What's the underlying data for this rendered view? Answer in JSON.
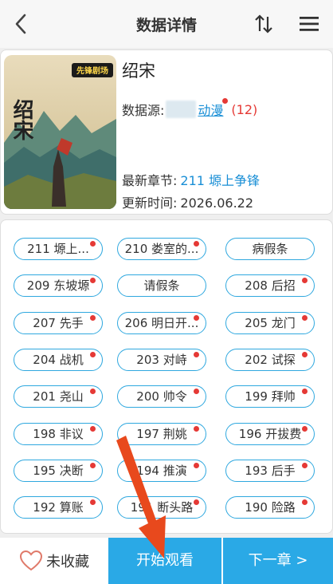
{
  "header": {
    "title": "数据详情"
  },
  "book": {
    "title": "绍宋",
    "cover_logo": "先锋剧场",
    "cover_text": "绍宋",
    "source_label": "数据源:",
    "source_name": "动漫",
    "source_count": "(12)",
    "latest_label": "最新章节:",
    "latest_value": "211 塬上争锋",
    "update_label": "更新时间:",
    "update_value": "2026.06.22"
  },
  "chapters": [
    {
      "label": "211 塬上...",
      "dot": true
    },
    {
      "label": "210 娄室的...",
      "dot": true
    },
    {
      "label": "病假条",
      "dot": false
    },
    {
      "label": "209 东坡塬",
      "dot": true
    },
    {
      "label": "请假条",
      "dot": false
    },
    {
      "label": "208 后招",
      "dot": true
    },
    {
      "label": "207 先手",
      "dot": true
    },
    {
      "label": "206 明日开...",
      "dot": true
    },
    {
      "label": "205 龙门",
      "dot": true
    },
    {
      "label": "204 战机",
      "dot": true
    },
    {
      "label": "203 对峙",
      "dot": true
    },
    {
      "label": "202 试探",
      "dot": true
    },
    {
      "label": "201 尧山",
      "dot": true
    },
    {
      "label": "200 帅令",
      "dot": true
    },
    {
      "label": "199 拜帅",
      "dot": true
    },
    {
      "label": "198 非议",
      "dot": true
    },
    {
      "label": "197 荆姚",
      "dot": true
    },
    {
      "label": "196 开拔费",
      "dot": true
    },
    {
      "label": "195 决断",
      "dot": true
    },
    {
      "label": "194 推演",
      "dot": true
    },
    {
      "label": "193 后手",
      "dot": true
    },
    {
      "label": "192 算账",
      "dot": true
    },
    {
      "label": "191 断头路",
      "dot": true
    },
    {
      "label": "190 险路",
      "dot": true
    }
  ],
  "bottom": {
    "favorite_label": "未收藏",
    "start_label": "开始观看",
    "next_label": "下一章 >"
  },
  "colors": {
    "accent": "#2aa9e6",
    "link": "#1a8fd6",
    "dot": "#e53935",
    "annotation_arrow": "#e8491d"
  }
}
